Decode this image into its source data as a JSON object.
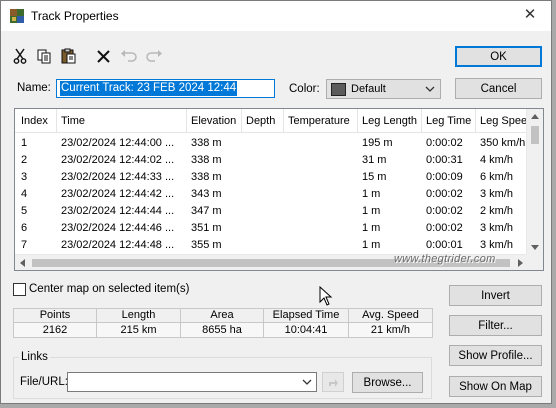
{
  "window": {
    "title": "Track Properties",
    "close_glyph": "✕"
  },
  "toolbar": {
    "icons": [
      "cut-icon",
      "copy-icon",
      "paste-icon",
      "delete-icon",
      "undo-icon",
      "redo-icon"
    ]
  },
  "name_field": {
    "label": "Name:",
    "value": "Current Track: 23 FEB 2024 12:44"
  },
  "color_field": {
    "label": "Color:",
    "value": "Default",
    "swatch": "#5b5b5b"
  },
  "buttons": {
    "ok": "OK",
    "cancel": "Cancel",
    "invert": "Invert",
    "filter": "Filter...",
    "show_profile": "Show Profile...",
    "show_on_map": "Show On Map",
    "browse": "Browse..."
  },
  "table": {
    "columns": [
      "Index",
      "Time",
      "Elevation",
      "Depth",
      "Temperature",
      "Leg Length",
      "Leg Time",
      "Leg Speed"
    ],
    "rows": [
      [
        "1",
        "23/02/2024 12:44:00 ...",
        "338 m",
        "",
        "",
        "195 m",
        "0:00:02",
        "350 km/h"
      ],
      [
        "2",
        "23/02/2024 12:44:02 ...",
        "338 m",
        "",
        "",
        "31 m",
        "0:00:31",
        "4 km/h"
      ],
      [
        "3",
        "23/02/2024 12:44:33 ...",
        "338 m",
        "",
        "",
        "15 m",
        "0:00:09",
        "6 km/h"
      ],
      [
        "4",
        "23/02/2024 12:44:42 ...",
        "343 m",
        "",
        "",
        "1 m",
        "0:00:02",
        "3 km/h"
      ],
      [
        "5",
        "23/02/2024 12:44:44 ...",
        "347 m",
        "",
        "",
        "1 m",
        "0:00:02",
        "2 km/h"
      ],
      [
        "6",
        "23/02/2024 12:44:46 ...",
        "351 m",
        "",
        "",
        "1 m",
        "0:00:02",
        "3 km/h"
      ],
      [
        "7",
        "23/02/2024 12:44:48 ...",
        "355 m",
        "",
        "",
        "1 m",
        "0:00:01",
        "3 km/h"
      ]
    ]
  },
  "center_map": {
    "label": "Center map on selected item(s)",
    "checked": false
  },
  "stats": [
    {
      "label": "Points",
      "value": "2162"
    },
    {
      "label": "Length",
      "value": "215 km"
    },
    {
      "label": "Area",
      "value": "8655 ha"
    },
    {
      "label": "Elapsed Time",
      "value": "10:04:41"
    },
    {
      "label": "Avg. Speed",
      "value": "21 km/h"
    }
  ],
  "links": {
    "group_label": "Links",
    "file_label": "File/URL:",
    "value": ""
  },
  "watermark": "www.thegtrider.com"
}
